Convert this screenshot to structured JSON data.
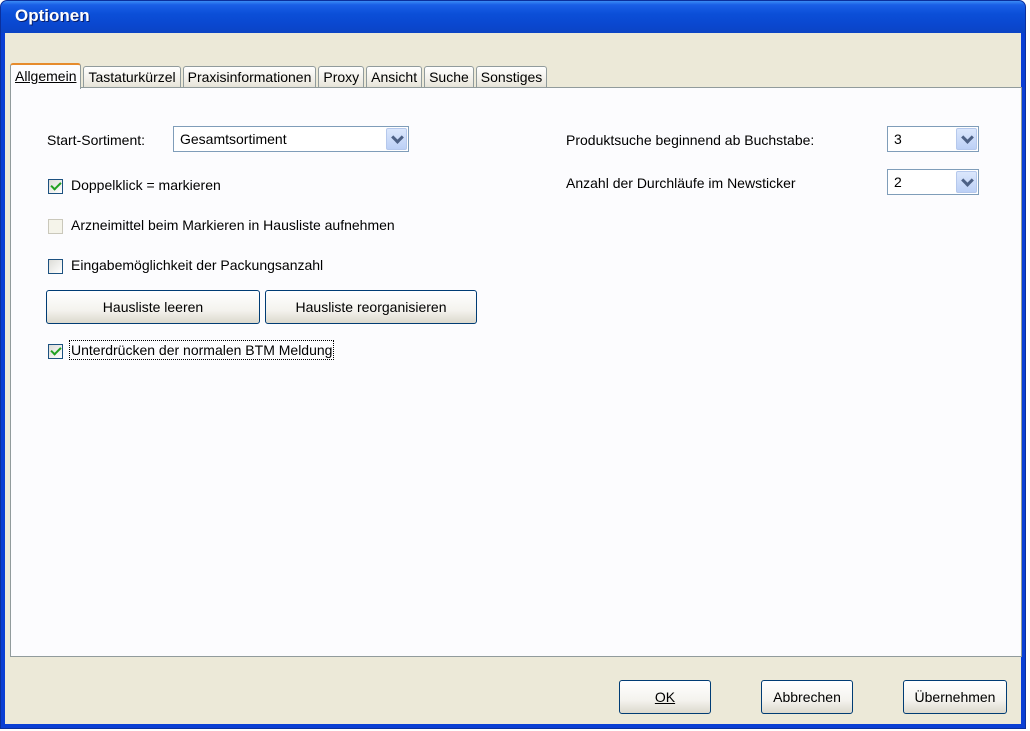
{
  "window": {
    "title": "Optionen"
  },
  "tabs": [
    {
      "label": "Allgemein",
      "active": true
    },
    {
      "label": "Tastaturkürzel",
      "active": false
    },
    {
      "label": "Praxisinformationen",
      "active": false
    },
    {
      "label": "Proxy",
      "active": false
    },
    {
      "label": "Ansicht",
      "active": false
    },
    {
      "label": "Suche",
      "active": false
    },
    {
      "label": "Sonstiges",
      "active": false
    }
  ],
  "general": {
    "start_assortment_label": "Start-Sortiment:",
    "start_assortment_value": "Gesamtsortiment",
    "double_click_label": "Doppelklick = markieren",
    "double_click_checked": true,
    "add_to_house_list_label": "Arzneimittel beim Markieren in Hausliste aufnehmen",
    "add_to_house_list_checked": false,
    "pack_count_label": "Eingabemöglichkeit der Packungsanzahl",
    "pack_count_checked": false,
    "clear_house_list_button": "Hausliste leeren",
    "reorganize_house_list_button": "Hausliste reorganisieren",
    "suppress_btm_label": "Unterdrücken der normalen BTM Meldung",
    "suppress_btm_checked": true,
    "product_search_label": "Produktsuche beginnend ab Buchstabe:",
    "product_search_value": "3",
    "newsticker_runs_label": "Anzahl der Durchläufe im Newsticker",
    "newsticker_runs_value": "2"
  },
  "footer": {
    "ok_button": "OK",
    "cancel_button": "Abbrechen",
    "apply_button": "Übernehmen"
  },
  "colors": {
    "title_bar": "#0a47cf",
    "client_bg": "#ece9d8",
    "panel_bg": "#fcfcfe",
    "tab_active_accent": "#e68b2c",
    "checkmark": "#21a121"
  }
}
